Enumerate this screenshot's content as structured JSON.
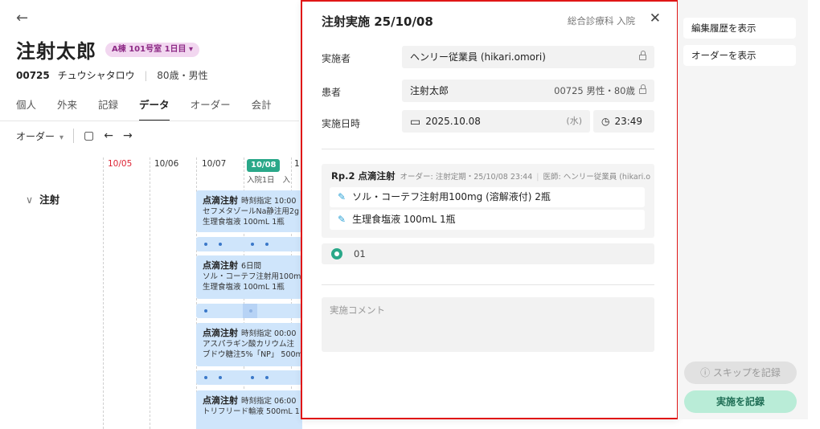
{
  "patient": {
    "name": "注射太郎",
    "room_badge": "A棟 101号室 1日目 ▾",
    "id": "00725",
    "kana": "チュウシャタロウ",
    "age_sex": "80歳・男性"
  },
  "tabs": [
    "個人",
    "外来",
    "記録",
    "データ",
    "オーダー",
    "会計"
  ],
  "toolbar": {
    "filter_label": "オーダー",
    "caret": "▾"
  },
  "timeline": {
    "dates": [
      "10/05",
      "10/06",
      "10/07",
      "10/08",
      "1"
    ],
    "today_label": "10/08",
    "today_sub": "入院1日",
    "next_sub": "入"
  },
  "section": {
    "label": "注射",
    "chevron": "∨"
  },
  "cards": [
    {
      "title": "点滴注射",
      "sub": "時刻指定 10:00",
      "lines": [
        "セフメタゾールNa静注用2g",
        "生理食塩液 100mL 1瓶"
      ]
    },
    {
      "title": "点滴注射",
      "sub": "6日間",
      "lines": [
        "ソル・コーテフ注射用100mg",
        "生理食塩液 100mL 1瓶"
      ]
    },
    {
      "title": "点滴注射",
      "sub": "時刻指定 00:00",
      "lines": [
        "アスパラギン酸カリウム注",
        "ブドウ糖注5%「NP」 500mL"
      ]
    },
    {
      "title": "点滴注射",
      "sub": "時刻指定 06:00",
      "lines": [
        "トリフリード輸液 500mL 1"
      ]
    }
  ],
  "modal": {
    "title": "注射実施 25/10/08",
    "dept": "総合診療科 入院",
    "close": "✕",
    "performer_label": "実施者",
    "performer_value": "ヘンリー従業員 (hikari.omori)",
    "patient_label": "患者",
    "patient_value": "注射太郎",
    "patient_right": "00725 男性・80歳",
    "datetime_label": "実施日時",
    "date_value": "2025.10.08",
    "weekday": "(水)",
    "time_value": "23:49",
    "rp_title": "Rp.2 点滴注射",
    "rp_meta": "オーダー: 注射定期・25/10/08 23:44",
    "rp_doctor": "医師: ヘンリー従業員 (hikari.o",
    "drugs": [
      "ソル・コーテフ注射用100mg (溶解液付) 2瓶",
      "生理食塩液 100mL 1瓶"
    ],
    "option_label": "01",
    "comment_placeholder": "実施コメント"
  },
  "right": {
    "history_button": "編集履歴を表示",
    "order_button": "オーダーを表示",
    "skip_button": "ⓘ スキップを記録",
    "done_button": "実施を記録"
  },
  "colors": {
    "accent": "#2aa889",
    "highlight_border": "#e01616",
    "card_bg": "#cfe5fb",
    "badge_bg": "#f2d7f0"
  }
}
